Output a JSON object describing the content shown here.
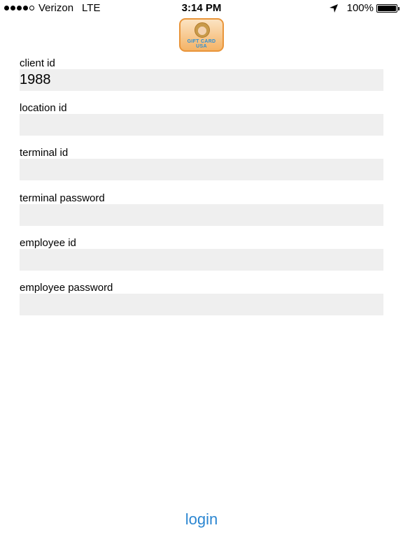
{
  "status_bar": {
    "carrier": "Verizon",
    "network": "LTE",
    "time": "3:14 PM",
    "battery_percent": "100%",
    "signal_bars_filled": 4,
    "signal_bars_total": 5
  },
  "logo": {
    "line1": "GIFT CARD",
    "line2": "USA"
  },
  "form": {
    "client_id": {
      "label": "client id",
      "value": "1988"
    },
    "location_id": {
      "label": "location id",
      "value": ""
    },
    "terminal_id": {
      "label": "terminal id",
      "value": ""
    },
    "terminal_password": {
      "label": "terminal password",
      "value": ""
    },
    "employee_id": {
      "label": "employee id",
      "value": ""
    },
    "employee_password": {
      "label": "employee password",
      "value": ""
    }
  },
  "login_label": "login",
  "colors": {
    "accent": "#2b86d1",
    "input_bg": "#efefef",
    "logo_border": "#e9953a"
  }
}
